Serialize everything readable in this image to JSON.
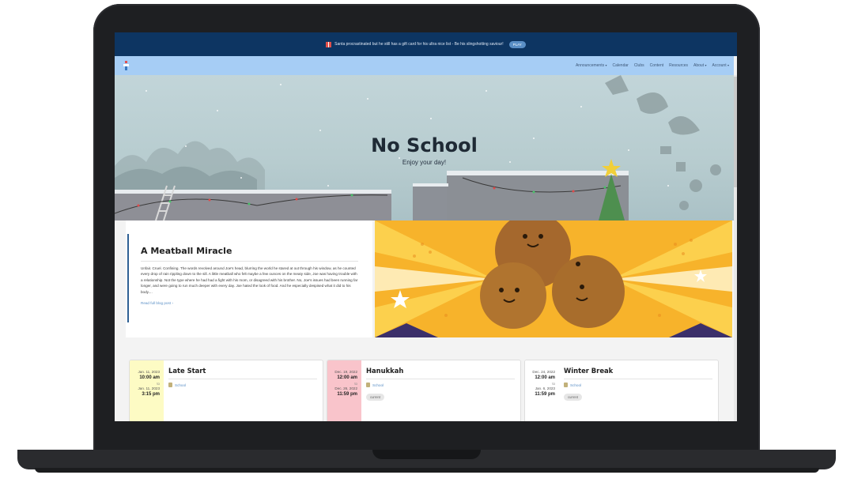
{
  "announcement": {
    "text": "Santa procrastinated but he still has a gift card for his ultra nice list - Be his slingshotting saviour!",
    "button": "PLAY"
  },
  "nav": {
    "items": [
      {
        "label": "Announcements",
        "dropdown": true
      },
      {
        "label": "Calendar",
        "dropdown": false
      },
      {
        "label": "Clubs",
        "dropdown": false
      },
      {
        "label": "Content",
        "dropdown": false
      },
      {
        "label": "Resources",
        "dropdown": false
      },
      {
        "label": "About",
        "dropdown": true
      },
      {
        "label": "Account",
        "dropdown": true
      }
    ]
  },
  "hero": {
    "title": "No School",
    "subtitle": "Enjoy your day!"
  },
  "blog": {
    "title": "A Meatball Miracle",
    "excerpt": "Unfair. Cruel. Confining. The words revolved around Joe's head, blurring the world he stared at out through his window, as he counted every drop of rain rippling down to the sill. A little meatball who felt maybe a few ounces on the meaty side, Joe was having trouble with a relationship. Not the type where he had had a fight with his mom, or disagreed with his brother. No, Joe's issues had been running far longer, and were going to run much deeper with every day. Joe hated the look of food. And he especially despised what it did to his body....",
    "link": "Read full blog post ›"
  },
  "events": [
    {
      "title": "Late Start",
      "start_date": "Jan. 11, 2023",
      "start_time": "10:00 am",
      "to": "to",
      "end_date": "Jan. 11, 2023",
      "end_time": "3:15 pm",
      "calendar": "School",
      "badge": "",
      "color": "#fdfbc4"
    },
    {
      "title": "Hanukkah",
      "start_date": "Dec. 19, 2022",
      "start_time": "12:00 am",
      "to": "to",
      "end_date": "Dec. 26, 2022",
      "end_time": "11:59 pm",
      "calendar": "School",
      "badge": "current",
      "color": "#f9c4cb"
    },
    {
      "title": "Winter Break",
      "start_date": "Dec. 24, 2022",
      "start_time": "12:00 am",
      "to": "to",
      "end_date": "Jan. 6, 2023",
      "end_time": "11:59 pm",
      "calendar": "School",
      "badge": "current",
      "color": "#ffffff"
    }
  ],
  "colors": {
    "banner": "#0d3562",
    "navbar": "#a6cdf5",
    "accent": "#2d5f93",
    "link": "#5a8fc6"
  }
}
